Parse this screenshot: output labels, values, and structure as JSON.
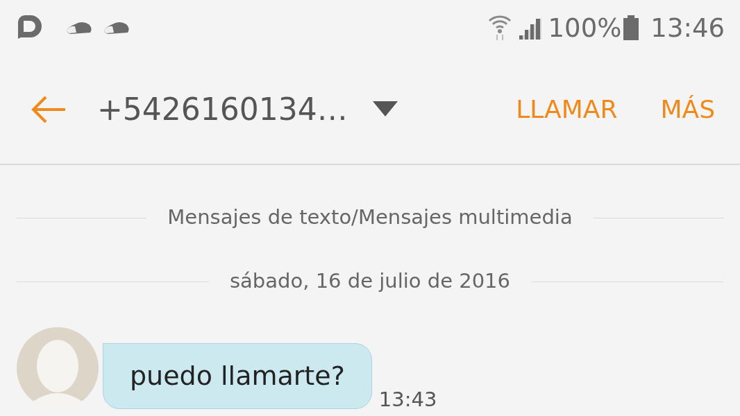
{
  "status_bar": {
    "battery": "100%",
    "time": "13:46"
  },
  "header": {
    "title": "+5426160134…",
    "actions": [
      "LLAMAR",
      "MÁS"
    ]
  },
  "dividers": [
    "Mensajes de texto/Mensajes multimedia",
    "sábado, 16 de julio de 2016"
  ],
  "messages": [
    {
      "text": "puedo llamarte?",
      "time": "13:43"
    }
  ]
}
